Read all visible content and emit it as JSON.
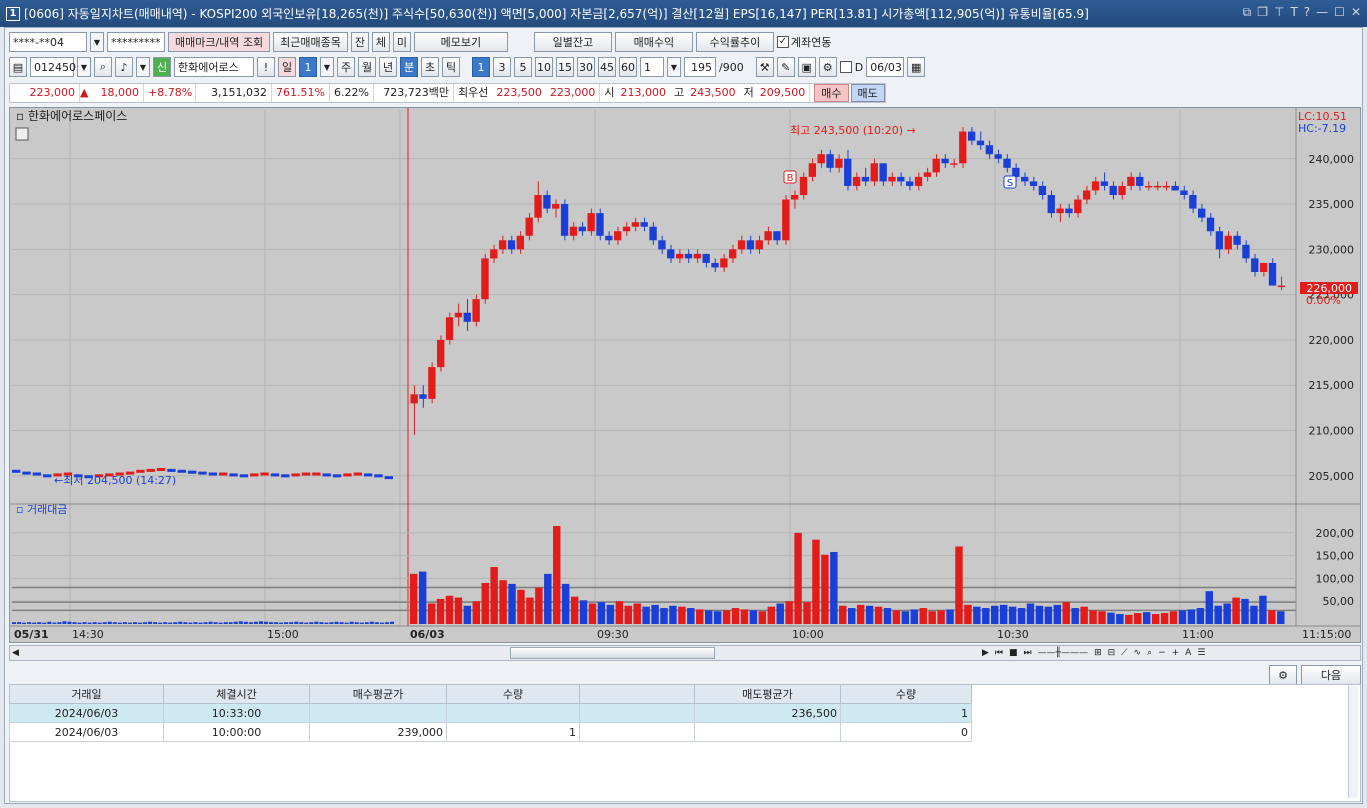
{
  "window": {
    "title": "[0606] 자동일지차트(매매내역) - KOSPI200 외국인보유[18,265(천)] 주식수[50,630(천)] 액면[5,000] 자본금[2,657(억)] 결산[12월] EPS[16,147] PER[13.81] 시가총액[112,905(억)] 유통비율[65.9]",
    "app_number": "1"
  },
  "toolbar1": {
    "account": "****-**04",
    "password": "*********",
    "trade_mark_btn": "매매마크/내역 조회",
    "recent_btn": "최근매매종목",
    "jan_btn": "잔",
    "che_btn": "체",
    "mi_btn": "미",
    "memo_btn": "메모보기",
    "daily_balance_btn": "일별잔고",
    "trade_profit_btn": "매매수익",
    "profit_trend_btn": "수익률추이",
    "account_link_label": "계좌연동"
  },
  "toolbar2": {
    "code": "012450",
    "sin_label": "신",
    "stock_name": "한화에어로스",
    "period_labels": [
      "일",
      "1",
      "주",
      "월",
      "년",
      "분",
      "초",
      "틱"
    ],
    "minute_labels": [
      "1",
      "3",
      "5",
      "10",
      "15",
      "30",
      "45",
      "60"
    ],
    "unit_value": "1",
    "count_value": "195",
    "count_max": "/900",
    "d_label": "D",
    "date_value": "06/03"
  },
  "quote": {
    "price": "223,000",
    "change": "18,000",
    "change_pct": "+8.78%",
    "volume": "3,151,032",
    "vol_ratio": "761.51%",
    "turnover": "6.22%",
    "amount": "723,723백만",
    "priority_label": "최우선",
    "ask": "223,500",
    "bid": "223,000",
    "open_label": "시",
    "open": "213,000",
    "high_label": "고",
    "high": "243,500",
    "low_label": "저",
    "low": "209,500",
    "buy_btn": "매수",
    "sell_btn": "매도"
  },
  "price_panel": {
    "name": "한화에어로스페이스",
    "lc": "LC:10.51",
    "hc": "HC:-7.19",
    "high_note": "최고 243,500 (10:20)",
    "low_note": "최저 204,500 (14:27)",
    "last_price": "226,000",
    "last_pct": "0.00%",
    "y_ticks": [
      "240,000",
      "235,000",
      "230,000",
      "225,000",
      "220,000",
      "215,000",
      "210,000",
      "205,000"
    ],
    "buy_marker": "B",
    "sell_marker": "S"
  },
  "volume_panel": {
    "name": "거래대금",
    "y_ticks": [
      "200,00",
      "150,00",
      "100,00",
      "50,00"
    ]
  },
  "x_axis": {
    "labels": [
      "05/31",
      "14:30",
      "15:00",
      "06/03",
      "09:30",
      "10:00",
      "10:30",
      "11:00",
      "11:15:00"
    ]
  },
  "colors": {
    "up": "#e21b1b",
    "down": "#1a3fd6",
    "bg": "#c9c9c9"
  },
  "chart_data": {
    "type": "candlestick",
    "title": "한화에어로스페이스",
    "y_range": [
      202000,
      244500
    ],
    "volume_range": [
      0,
      215
    ],
    "candles_day1_close": [
      205.5,
      205.3,
      205.2,
      205,
      205.1,
      205.2,
      205,
      204.9,
      205,
      205.1,
      205.2,
      205.3,
      205.5,
      205.6,
      205.7,
      205.6,
      205.5,
      205.4,
      205.3,
      205.2,
      205.2,
      205.1,
      205,
      205.1,
      205.2,
      205.1,
      205,
      205.1,
      205.2,
      205.2,
      205.1,
      205,
      205.1,
      205.2,
      205.1,
      205,
      204.8
    ],
    "candles_day2": [
      [
        213,
        215,
        209.5,
        214
      ],
      [
        214,
        215,
        212.5,
        213.5
      ],
      [
        213.5,
        217.5,
        213,
        217
      ],
      [
        217,
        220.5,
        216.5,
        220
      ],
      [
        220,
        223,
        219.5,
        222.5
      ],
      [
        222.5,
        224,
        221.5,
        223
      ],
      [
        223,
        224.5,
        221,
        222
      ],
      [
        222,
        225,
        221.5,
        224.5
      ],
      [
        224.5,
        229.5,
        224,
        229
      ],
      [
        229,
        230.5,
        228.5,
        230
      ],
      [
        230,
        231.5,
        229.5,
        231
      ],
      [
        231,
        231.5,
        229.5,
        230
      ],
      [
        230,
        232,
        229.5,
        231.5
      ],
      [
        231.5,
        234,
        231,
        233.5
      ],
      [
        233.5,
        237.5,
        233,
        236
      ],
      [
        236,
        236.5,
        234,
        234.5
      ],
      [
        234.5,
        235.5,
        233.5,
        235
      ],
      [
        235,
        235.5,
        231,
        231.5
      ],
      [
        231.5,
        233,
        231,
        232.5
      ],
      [
        232.5,
        233,
        231.5,
        232
      ],
      [
        232,
        234.5,
        231.5,
        234
      ],
      [
        234,
        234.5,
        231,
        231.5
      ],
      [
        231.5,
        232,
        230.5,
        231
      ],
      [
        231,
        232.5,
        230.5,
        232
      ],
      [
        232,
        233,
        231.5,
        232.5
      ],
      [
        232.5,
        233.5,
        232,
        233
      ],
      [
        233,
        233.5,
        232,
        232.5
      ],
      [
        232.5,
        233,
        230.5,
        231
      ],
      [
        231,
        231.5,
        229.5,
        230
      ],
      [
        230,
        230.5,
        228.5,
        229
      ],
      [
        229,
        230,
        228.5,
        229.5
      ],
      [
        229.5,
        230,
        228.5,
        229
      ],
      [
        229,
        230,
        228.5,
        229.5
      ],
      [
        229.5,
        229.5,
        228,
        228.5
      ],
      [
        228.5,
        229,
        227.5,
        228
      ],
      [
        228,
        229.5,
        227.5,
        229
      ],
      [
        229,
        230.5,
        228.5,
        230
      ],
      [
        230,
        231.5,
        229.5,
        231
      ],
      [
        231,
        231.5,
        229.5,
        230
      ],
      [
        230,
        231.5,
        229.5,
        231
      ],
      [
        231,
        232.5,
        230.5,
        232
      ],
      [
        232,
        232,
        230.5,
        231
      ],
      [
        231,
        236,
        230.5,
        235.5
      ],
      [
        235.5,
        236.5,
        234.5,
        236
      ],
      [
        236,
        238.5,
        235.5,
        238
      ],
      [
        238,
        240,
        237.5,
        239.5
      ],
      [
        239.5,
        241,
        239,
        240.5
      ],
      [
        240.5,
        241,
        238.5,
        239
      ],
      [
        239,
        240.5,
        238.5,
        240
      ],
      [
        240,
        241,
        236.5,
        237
      ],
      [
        237,
        238.5,
        236.5,
        238
      ],
      [
        238,
        239,
        237,
        237.5
      ],
      [
        237.5,
        240,
        237,
        239.5
      ],
      [
        239.5,
        239.5,
        237,
        237.5
      ],
      [
        237.5,
        238.5,
        237,
        238
      ],
      [
        238,
        238.5,
        237,
        237.5
      ],
      [
        237.5,
        238,
        236.5,
        237
      ],
      [
        237,
        238.5,
        236.5,
        238
      ],
      [
        238,
        239,
        237.5,
        238.5
      ],
      [
        238.5,
        240.5,
        238,
        240
      ],
      [
        240,
        240.5,
        239,
        239.5
      ],
      [
        239.5,
        240,
        239,
        239.5
      ],
      [
        239.5,
        243.5,
        239,
        243
      ],
      [
        243,
        243.5,
        241.5,
        242
      ],
      [
        242,
        243,
        241,
        241.5
      ],
      [
        241.5,
        242,
        240,
        240.5
      ],
      [
        240.5,
        241,
        239.5,
        240
      ],
      [
        240,
        240.5,
        238.5,
        239
      ],
      [
        239,
        239.5,
        237.5,
        238
      ],
      [
        238,
        238.5,
        237,
        237.5
      ],
      [
        237.5,
        238,
        236.5,
        237
      ],
      [
        237,
        237.5,
        235.5,
        236
      ],
      [
        236,
        236.5,
        233.5,
        234
      ],
      [
        234,
        235,
        233,
        234.5
      ],
      [
        234.5,
        235,
        233.5,
        234
      ],
      [
        234,
        236,
        233.5,
        235.5
      ],
      [
        235.5,
        237,
        235,
        236.5
      ],
      [
        236.5,
        238,
        236,
        237.5
      ],
      [
        237.5,
        238.5,
        236.5,
        237
      ],
      [
        237,
        237.5,
        235.5,
        236
      ],
      [
        236,
        237.5,
        235.5,
        237
      ],
      [
        237,
        238.5,
        236.5,
        238
      ],
      [
        238,
        238.5,
        236.5,
        237
      ],
      [
        237,
        237.5,
        236.5,
        237
      ],
      [
        237,
        237.5,
        236.5,
        237
      ],
      [
        237,
        237.5,
        236.5,
        237
      ],
      [
        237,
        237.5,
        236.5,
        236.5
      ],
      [
        236.5,
        237,
        235.5,
        236
      ],
      [
        236,
        236.5,
        234,
        234.5
      ],
      [
        234.5,
        235,
        233,
        233.5
      ],
      [
        233.5,
        234,
        231.5,
        232
      ],
      [
        232,
        232.5,
        229,
        230
      ],
      [
        230,
        232,
        229.5,
        231.5
      ],
      [
        231.5,
        232,
        230,
        230.5
      ],
      [
        230.5,
        231,
        228.5,
        229
      ],
      [
        229,
        229.5,
        227,
        227.5
      ],
      [
        227.5,
        228.5,
        227,
        228.5
      ],
      [
        228.5,
        229,
        226,
        226
      ],
      [
        226,
        227,
        225.5,
        226
      ]
    ],
    "volumes_day1": [
      4,
      4,
      3,
      4,
      3,
      4,
      3,
      5,
      3,
      4,
      6,
      5,
      4,
      3,
      4,
      3,
      4,
      3,
      4,
      5,
      4,
      3,
      4,
      3,
      4,
      3,
      4,
      5,
      4,
      3,
      4,
      3,
      4,
      5,
      4,
      3,
      4,
      3,
      4,
      5,
      4,
      3,
      4,
      4,
      5,
      6,
      5,
      4,
      5,
      6,
      5,
      4,
      4,
      3,
      4,
      4,
      5,
      4,
      3,
      4,
      5,
      4,
      3,
      4,
      5,
      4,
      3,
      5,
      4,
      3,
      4,
      5,
      4,
      3,
      4,
      5
    ],
    "volumes_day2": [
      110,
      115,
      45,
      55,
      62,
      58,
      40,
      50,
      90,
      125,
      96,
      88,
      75,
      58,
      80,
      110,
      215,
      88,
      60,
      52,
      45,
      48,
      42,
      50,
      40,
      45,
      38,
      42,
      35,
      40,
      38,
      35,
      32,
      30,
      28,
      30,
      35,
      32,
      30,
      28,
      38,
      45,
      50,
      200,
      48,
      185,
      152,
      158,
      40,
      35,
      42,
      40,
      38,
      35,
      30,
      28,
      32,
      35,
      28,
      30,
      32,
      170,
      42,
      38,
      35,
      40,
      42,
      38,
      35,
      45,
      40,
      38,
      42,
      48,
      35,
      38,
      30,
      28,
      25,
      22,
      20,
      24,
      26,
      22,
      24,
      28,
      30,
      32,
      35,
      72,
      40,
      45,
      58,
      55,
      40,
      62,
      30,
      28
    ]
  },
  "bottom_controls": {
    "next_btn": "다음"
  },
  "table": {
    "headers": [
      "거래일",
      "체결시간",
      "매수평균가",
      "수량",
      "",
      "매도평균가",
      "수량"
    ],
    "rows": [
      [
        "2024/06/03",
        "10:33:00",
        "",
        "",
        "",
        "236,500",
        "1"
      ],
      [
        "2024/06/03",
        "10:00:00",
        "239,000",
        "1",
        "",
        "",
        "0"
      ]
    ]
  }
}
